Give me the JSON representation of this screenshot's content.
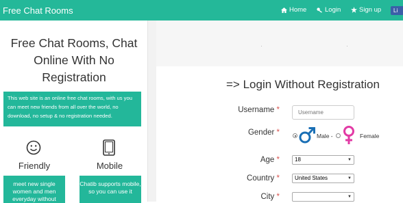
{
  "header": {
    "brand": "Free Chat Rooms",
    "nav": [
      {
        "label": "Home",
        "icon": "home-icon"
      },
      {
        "label": "Login",
        "icon": "key-icon"
      },
      {
        "label": "Sign up",
        "icon": "star-icon"
      }
    ],
    "facebook_label": "Li"
  },
  "sidebar": {
    "title": "Free Chat Rooms, Chat Online With No Registration",
    "intro": "This web site is an online free chat rooms, with us you can meet new friends from all over the world, no download, no setup & no registration needed.",
    "features": [
      {
        "icon": "smiley-icon",
        "label": "Friendly",
        "text": "meet new single women and men everyday without"
      },
      {
        "icon": "tablet-icon",
        "label": "Mobile",
        "text": "Chatib supports mobile, so you can use it"
      }
    ]
  },
  "form": {
    "title": "=> Login Without Registration",
    "username_label": "Username",
    "username_placeholder": "Username",
    "gender_label": "Gender",
    "male_label": "Male -",
    "female_label": "Female",
    "age_label": "Age",
    "age_value": "18",
    "country_label": "Country",
    "country_value": "United States",
    "city_label": "City",
    "city_value": "",
    "required_mark": "*"
  },
  "colors": {
    "primary": "#24b899",
    "male": "#1a6fb5",
    "female": "#e23aa5",
    "required": "#d9534f",
    "facebook": "#3b5fa8"
  }
}
